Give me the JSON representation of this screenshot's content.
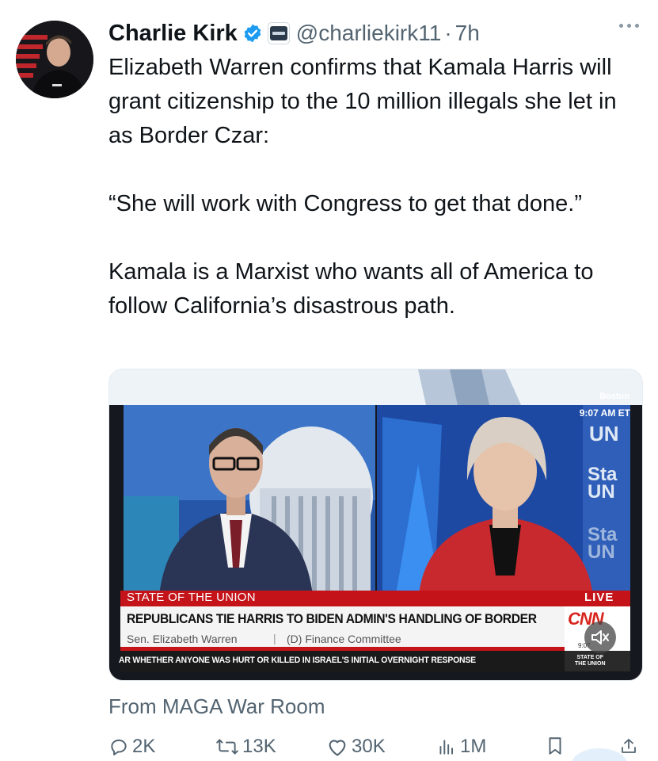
{
  "tweet": {
    "author_name": "Charlie Kirk",
    "handle": "@charliekirk11",
    "separator": "·",
    "time": "7h",
    "paragraphs": [
      "Elizabeth Warren confirms that Kamala Harris will grant citizenship to the 10 million illegals she let in as Border Czar:",
      "“She will work with Congress to get that done.”",
      "Kamala is a Marxist who wants all of America to follow California’s disastrous path."
    ]
  },
  "video": {
    "location": "Boston",
    "clock": "9:07 AM ET",
    "show_label": "STATE OF THE UNION",
    "live_label": "LIVE",
    "headline": "REPUBLICANS TIE HARRIS TO BIDEN ADMIN'S HANDLING OF BORDER",
    "guest_name": "Sen. Elizabeth Warren",
    "guest_separator": "|",
    "guest_role": "(D) Finance Committee",
    "ticker": "AR WHETHER ANYONE WAS HURT OR KILLED IN ISRAEL'S INITIAL OVERNIGHT RESPONSE",
    "network": "CNN",
    "small_time": "9:07",
    "show_logo_line1": "STATE OF",
    "show_logo_line2": "THE UNION"
  },
  "source": "From MAGA War Room",
  "actions": {
    "replies": "2K",
    "reposts": "13K",
    "likes": "30K",
    "views": "1M"
  },
  "icons": [
    "verified-badge-icon",
    "affiliate-badge-icon",
    "more-options-icon",
    "mute-icon",
    "reply-icon",
    "repost-icon",
    "like-icon",
    "views-icon",
    "bookmark-icon",
    "share-icon"
  ],
  "colors": {
    "verified": "#1d9bf0",
    "secondary_text": "#536471",
    "lower_third_red": "#c4141a",
    "cnn_red": "#d7261e"
  }
}
